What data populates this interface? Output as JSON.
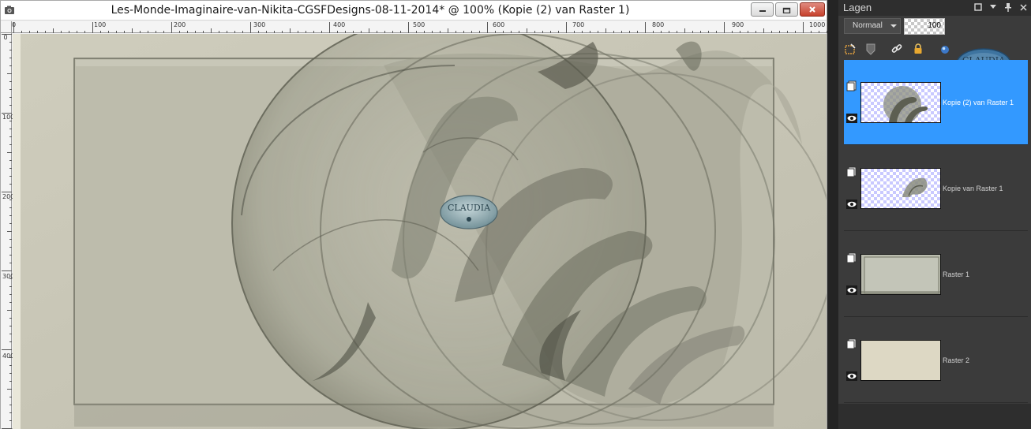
{
  "window": {
    "title": "Les-Monde-Imaginaire-van-Nikita-CGSFDesigns-08-11-2014* @ 100% (Kopie (2) van Raster 1)"
  },
  "ruler": {
    "h_labels": [
      "0",
      "100",
      "200",
      "300",
      "400",
      "500",
      "600",
      "700",
      "800",
      "900",
      "1000"
    ],
    "v_labels": [
      "0",
      "100",
      "200",
      "300",
      "400"
    ]
  },
  "canvas": {
    "watermark_text": "CLAUDIA",
    "colors": {
      "background": "#c8c6b6",
      "paper": "#bab9a9",
      "swirl": "#8d8e80"
    }
  },
  "layers_panel": {
    "title": "Lagen",
    "blend_mode": "Normaal",
    "opacity": "100",
    "toolbar_icons": [
      "new-raster-layer-icon",
      "mask-icon",
      "link-icon",
      "lock-icon",
      "visibility-icon"
    ],
    "selected_color": "#3399ff",
    "layers": [
      {
        "name": "Kopie (2) van Raster 1",
        "selected": true,
        "thumb": "swirl-large"
      },
      {
        "name": "Kopie van Raster 1",
        "selected": false,
        "thumb": "swirl-small"
      },
      {
        "name": "Raster 1",
        "selected": false,
        "thumb": "texture"
      },
      {
        "name": "Raster 2",
        "selected": false,
        "thumb": "solid"
      }
    ],
    "raster2_color": "#ddd8c4"
  }
}
